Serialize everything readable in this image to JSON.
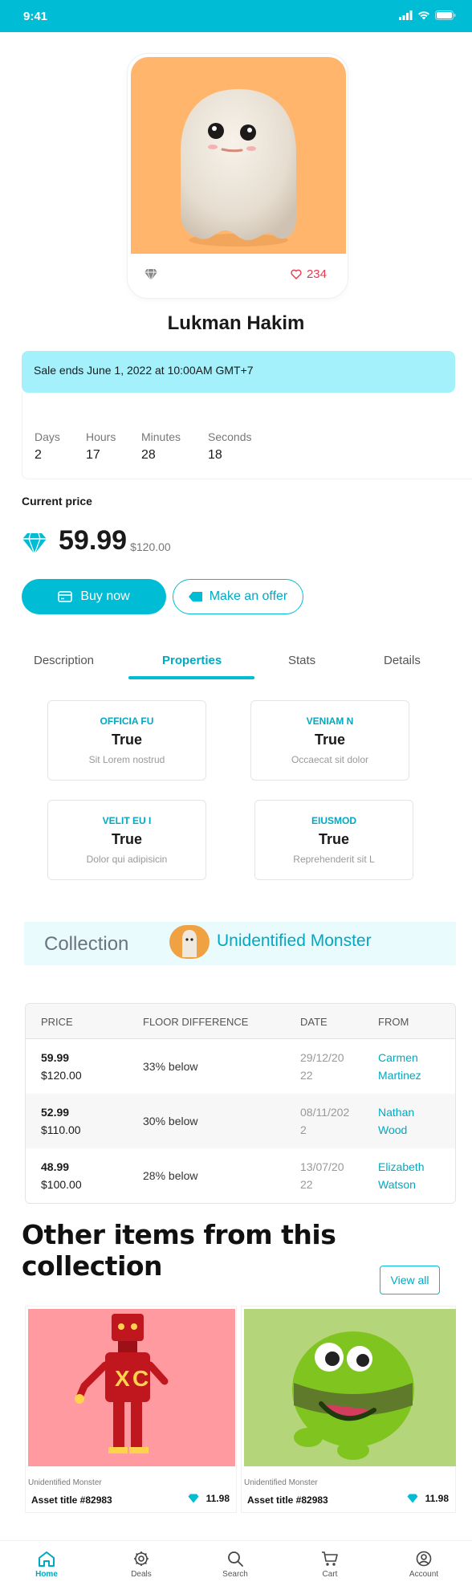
{
  "status_bar": {
    "time": "9:41"
  },
  "nft": {
    "likes": "234",
    "owner": "Lukman Hakim"
  },
  "sale": {
    "banner": "Sale ends June 1, 2022 at 10:00AM GMT+7",
    "countdown": [
      {
        "label": "Days",
        "value": "2"
      },
      {
        "label": "Hours",
        "value": "17"
      },
      {
        "label": "Minutes",
        "value": "28"
      },
      {
        "label": "Seconds",
        "value": "18"
      }
    ]
  },
  "pricing": {
    "label": "Current price",
    "price": "59.99",
    "old_price": "$120.00"
  },
  "actions": {
    "buy": "Buy now",
    "offer": "Make an offer"
  },
  "tabs": [
    {
      "label": "Description",
      "active": false
    },
    {
      "label": "Properties",
      "active": true
    },
    {
      "label": "Stats",
      "active": false
    },
    {
      "label": "Details",
      "active": false
    }
  ],
  "properties": [
    {
      "type": "OFFICIA FU",
      "value": "True",
      "desc": "Sit Lorem nostrud"
    },
    {
      "type": "VENIAM N",
      "value": "True",
      "desc": "Occaecat sit dolor"
    },
    {
      "type": "VELIT EU I",
      "value": "True",
      "desc": "Dolor qui adipisicin"
    },
    {
      "type": "EIUSMOD",
      "value": "True",
      "desc": "Reprehenderit sit L"
    }
  ],
  "collection": {
    "label": "Collection",
    "name": "Unidentified Monster"
  },
  "history": {
    "headers": [
      "PRICE",
      "FLOOR DIFFERENCE",
      "DATE",
      "FROM"
    ],
    "rows": [
      {
        "price": "59.99",
        "usd": "$120.00",
        "floor": "33% below",
        "date": "29/12/2022",
        "from": "Carmen Martinez"
      },
      {
        "price": "52.99",
        "usd": "$110.00",
        "floor": "30% below",
        "date": "08/11/2022",
        "from": "Nathan Wood"
      },
      {
        "price": "48.99",
        "usd": "$100.00",
        "floor": "28% below",
        "date": "13/07/2022",
        "from": "Elizabeth Watson"
      }
    ]
  },
  "other_items": {
    "title": "Other items from this collection",
    "view_all": "View all",
    "items": [
      {
        "collection": "Unidentified Monster",
        "title": "Asset title #82983",
        "price": "11.98",
        "bg": "#ff9aa0"
      },
      {
        "collection": "Unidentified Monster",
        "title": "Asset title #82983",
        "price": "11.98",
        "bg": "#b5d57a"
      }
    ]
  },
  "bottom_nav": [
    {
      "label": "Home",
      "icon": "home-icon",
      "active": true
    },
    {
      "label": "Deals",
      "icon": "gear-icon",
      "active": false
    },
    {
      "label": "Search",
      "icon": "search-icon",
      "active": false
    },
    {
      "label": "Cart",
      "icon": "cart-icon",
      "active": false
    },
    {
      "label": "Account",
      "icon": "account-icon",
      "active": false
    }
  ],
  "colors": {
    "accent": "#00bcd4",
    "banner": "#a4f1fb",
    "like": "#e53950",
    "nft_bg": "#ffb56b"
  }
}
